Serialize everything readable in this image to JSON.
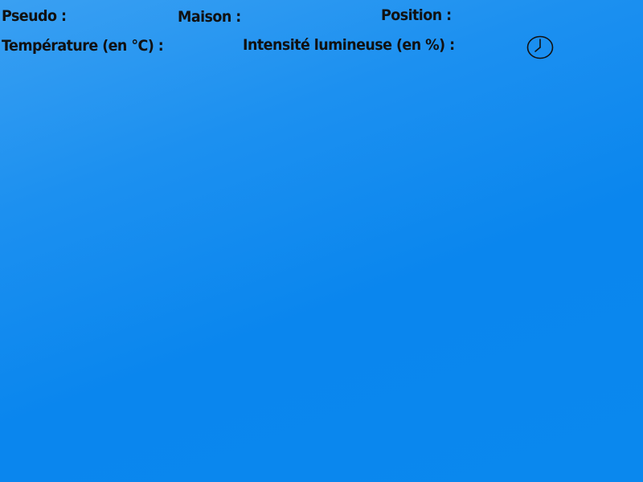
{
  "header": {
    "pseudo_label": "Pseudo :",
    "maison_label": "Maison :",
    "position_label": "Position :",
    "temperature_label": "Température (en °C) :",
    "light_intensity_label": "Intensité lumineuse (en %) :"
  },
  "icons": {
    "clock": "clock-icon"
  },
  "colors": {
    "background_start": "#3aa0f2",
    "background_end": "#0a88ee",
    "text": "#111111"
  }
}
